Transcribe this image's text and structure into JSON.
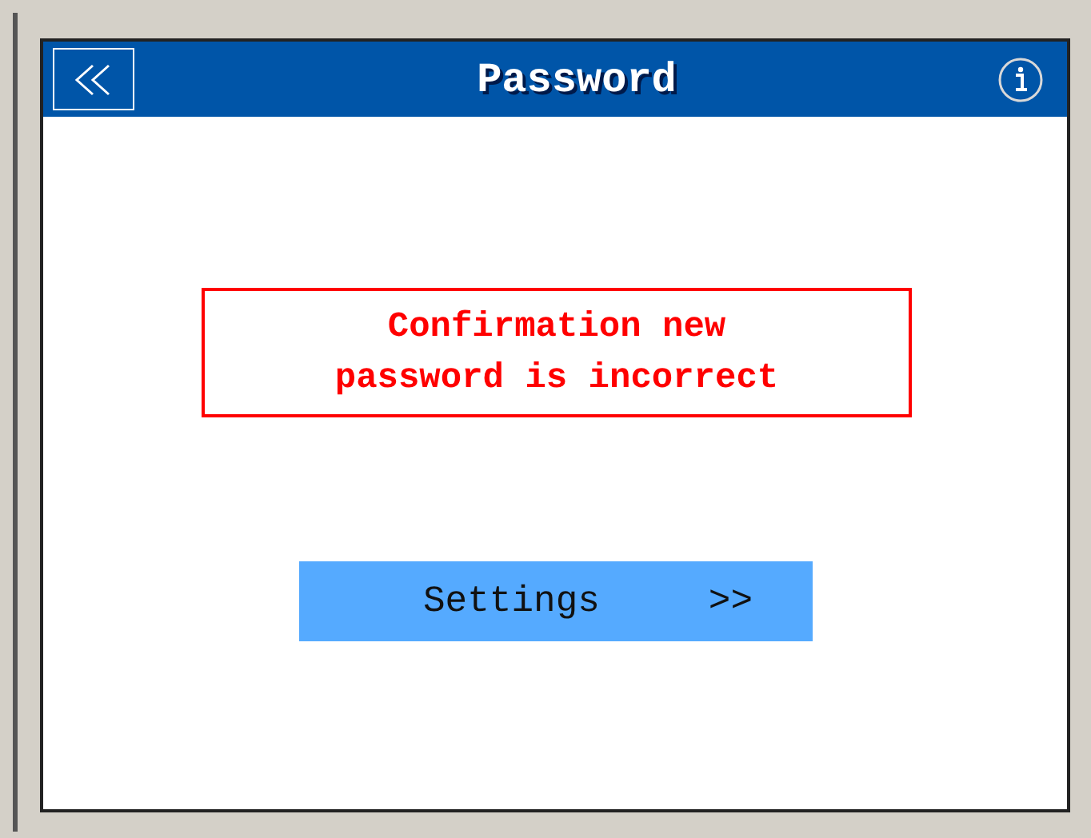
{
  "header": {
    "title": "Password"
  },
  "message": "Confirmation new password is incorrect",
  "settings_button": {
    "label": "Settings",
    "arrow": ">>"
  }
}
